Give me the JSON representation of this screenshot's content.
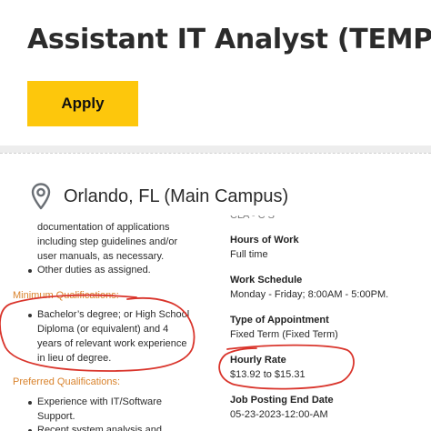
{
  "header": {
    "job_title": "Assistant IT Analyst (TEMP)",
    "apply_label": "Apply"
  },
  "location": {
    "icon": "map-pin-icon",
    "text": "Orlando, FL (Main Campus)"
  },
  "description": {
    "duties_continued": [
      "documentation of applications",
      "including step guidelines and/or",
      "user manuals, as necessary."
    ],
    "other_duty": "Other duties as assigned.",
    "minimum_qualifications_heading": "Minimum Qualifications:",
    "minimum_qualifications_lines": [
      "Bachelor’s degree; or High School",
      "Diploma (or equivalent) and 4",
      "years of relevant work experience",
      "in lieu of degree."
    ],
    "preferred_qualifications_heading": "Preferred Qualifications:",
    "preferred_lines": [
      "Experience with IT/Software",
      "Support.",
      "Recent system analysis and"
    ]
  },
  "details": {
    "top_cut_text": "CLA - C S",
    "hours_label": "Hours of Work",
    "hours_value": "Full time",
    "schedule_label": "Work Schedule",
    "schedule_value": "Monday - Friday; 8:00AM - 5:00PM.",
    "appointment_label": "Type of Appointment",
    "appointment_value": "Fixed Term (Fixed Term)",
    "rate_label": "Hourly Rate",
    "rate_value": "$13.92 to $15.31",
    "end_date_label": "Job Posting End Date",
    "end_date_value": "05-23-2023-12:00-AM"
  },
  "colors": {
    "apply_button": "#fdc70c",
    "section_heading": "#d9822b",
    "annotation": "#d9342b"
  }
}
